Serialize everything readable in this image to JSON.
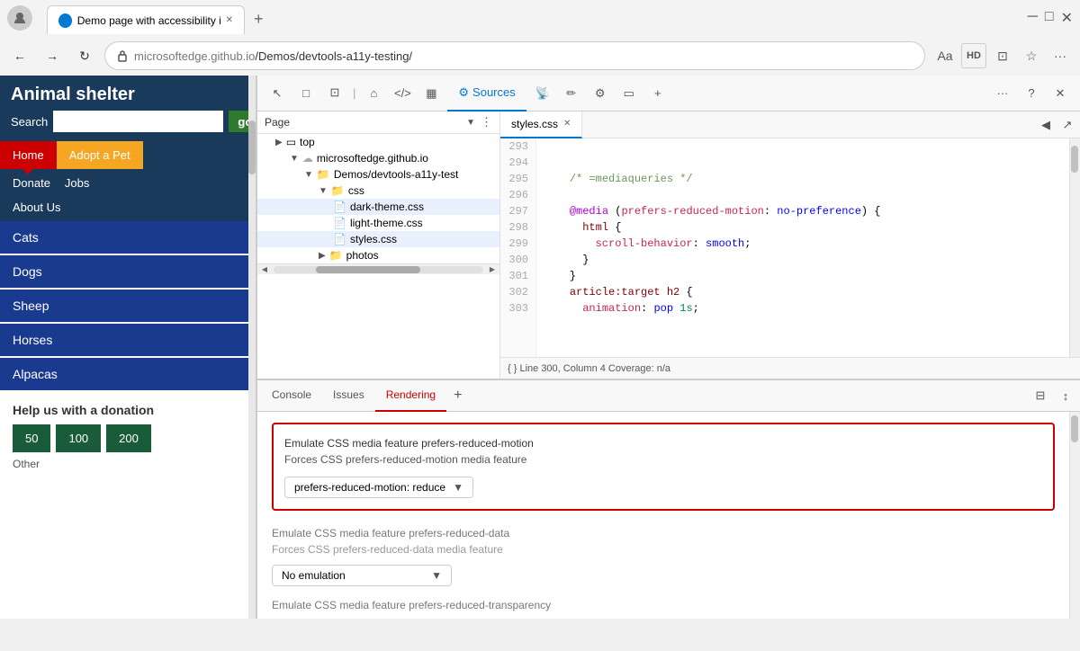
{
  "browser": {
    "tab_title": "Demo page with accessibility iss",
    "url": "microsoftedge.github.io/Demos/devtools-a11y-testing/",
    "url_domain": "microsoftedge.github.io",
    "url_path": "/Demos/devtools-a11y-testing/",
    "new_tab_label": "+",
    "nav_back": "←",
    "nav_forward": "→",
    "nav_refresh": "↻",
    "toolbar_icons": [
      "Aa",
      "HD",
      "⊡",
      "☆",
      "···"
    ]
  },
  "website": {
    "title": "Animal shelter",
    "search_label": "Search",
    "search_placeholder": "",
    "search_go": "go",
    "nav": {
      "home": "Home",
      "adopt": "Adopt a Pet",
      "donate": "Donate",
      "jobs": "Jobs",
      "about": "About Us"
    },
    "sidebar_items": [
      "Cats",
      "Dogs",
      "Sheep",
      "Horses",
      "Alpacas"
    ],
    "donation": {
      "title": "Help us with a donation",
      "amounts": [
        "50",
        "100",
        "200"
      ],
      "other": "Other"
    }
  },
  "devtools": {
    "toolbar_icons": [
      "↖",
      "☐",
      "☰",
      "⌂",
      "</>",
      "▦",
      "Sources",
      "📡",
      "✏",
      "⚙",
      "▭",
      "+"
    ],
    "sources_tab": "Sources",
    "panel_header": "Page",
    "more_options": "···",
    "help": "?",
    "close": "✕",
    "tree": {
      "top": "top",
      "host": "microsoftedge.github.io",
      "folder1": "Demos/devtools-a11y-test",
      "folder_css": "css",
      "file1": "dark-theme.css",
      "file2": "light-theme.css",
      "file3": "styles.css",
      "folder_photos": "photos"
    },
    "editor": {
      "file_tab": "styles.css",
      "lines": [
        {
          "num": "293",
          "content": ""
        },
        {
          "num": "294",
          "content": ""
        },
        {
          "num": "295",
          "content": "    /* =mediaqueries */"
        },
        {
          "num": "296",
          "content": ""
        },
        {
          "num": "297",
          "content": "    @media (prefers-reduced-motion: no-preference) {"
        },
        {
          "num": "298",
          "content": "      html {"
        },
        {
          "num": "299",
          "content": "        scroll-behavior: smooth;"
        },
        {
          "num": "300",
          "content": "      }"
        },
        {
          "num": "301",
          "content": "    }"
        },
        {
          "num": "302",
          "content": "    article:target h2 {"
        },
        {
          "num": "303",
          "content": "      animation: pop 1s;"
        }
      ],
      "status": "{ }  Line 300, Column 4    Coverage: n/a"
    },
    "bottom_tabs": [
      "Console",
      "Issues",
      "Rendering"
    ],
    "rendering": {
      "active_tab": "Rendering",
      "feature1_title": "Emulate CSS media feature prefers-reduced-motion",
      "feature1_subtitle": "Forces CSS prefers-reduced-motion media feature",
      "feature1_value": "prefers-reduced-motion: reduce",
      "feature2_title": "Emulate CSS media feature prefers-reduced-data",
      "feature2_subtitle": "Forces CSS prefers-reduced-data media feature",
      "feature2_value": "No emulation",
      "feature3_title": "Emulate CSS media feature prefers-reduced-transparency"
    }
  }
}
